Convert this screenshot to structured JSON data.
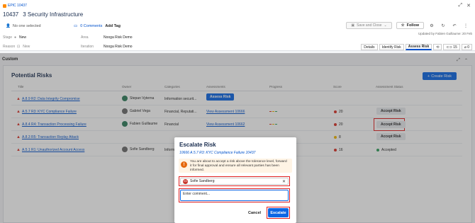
{
  "header": {
    "epic_tag": "EPIC 10437",
    "issue_key": "10437",
    "issue_title": "3 Security Infrastructure",
    "assignee": "No one selected",
    "comments": "0 Comments",
    "add_tag": "Add Tag",
    "save_close": "Save and Close",
    "follow": "Follow",
    "updated": "Updated by Fabien Guillaume: 20 Feb",
    "fields": {
      "stage_label": "Stage",
      "stage_value": "New",
      "area_label": "Area",
      "area_value": "Nooga Risk Demo",
      "reason_label": "Reason",
      "reason_value": "New",
      "location_label": "Iteration",
      "location_value": "Nooga Risk Demo"
    },
    "tabs": [
      "Details",
      "Identify Risk",
      "Assess Risk"
    ],
    "badge_links": "15",
    "badge_attach": "0"
  },
  "section": {
    "custom_label": "Custom",
    "panel_title": "Potential Risks",
    "create_button": "Create Risk",
    "columns": [
      "Title",
      "Owner",
      "Categories",
      "Assessments",
      "Progress",
      "Score",
      "Assessment Status"
    ]
  },
  "rows": [
    {
      "title": "A.8.9 R2: Data Integrity Compromise",
      "owner": "Stepan Vyterna",
      "owner_color": "#2e7d5b",
      "categories": "Information securit...",
      "assessment": "Assess Risk",
      "score": "",
      "score_color": "",
      "status": ""
    },
    {
      "title": "A.5.7 R3: KYC Compliance Failure",
      "owner": "Gabriel Vega",
      "owner_color": "#6b6b6b",
      "categories": "Financial, Reputati...",
      "assessment": "View Assessment 10666",
      "score": "20",
      "score_color": "#d93025",
      "status": "Accept Risk"
    },
    {
      "title": "A.8.4 R4: Transaction Processing Failure",
      "owner": "Fabien Guillaume",
      "owner_color": "#2e7d5b",
      "categories": "Financial",
      "assessment": "View Assessment 10662",
      "score": "20",
      "score_color": "#d93025",
      "status": "Accept Risk"
    },
    {
      "title": "A.8.3 R5: Transaction Replay Attack",
      "owner": "",
      "owner_color": "",
      "categories": "",
      "assessment": "",
      "score": "8",
      "score_color": "#f2b600",
      "status": "Accept Risk"
    },
    {
      "title": "A.5.1 R1: Unauthorized Account Access",
      "owner": "Sofie Sandberg",
      "owner_color": "#6b6b6b",
      "categories": "Inform",
      "assessment": "",
      "score": "16",
      "score_color": "#d93025",
      "status": "Accepted"
    }
  ],
  "modal": {
    "title": "Escalate Risk",
    "subtitle": "10666 A.5.7 R3: KYC Compliance Failure 10437",
    "warning": "You are about to accept a risk above the tolerance level, forward it for final approval and ensure all relevant parties has been informed.",
    "user_initials": "SS",
    "user_name": "Sofie Sandberg",
    "comment_placeholder": "Enter comment...",
    "cancel": "Cancel",
    "escalate": "Escalate"
  },
  "colors": {
    "accent": "#0c66e4",
    "danger": "#d93025",
    "warning": "#e56910"
  }
}
